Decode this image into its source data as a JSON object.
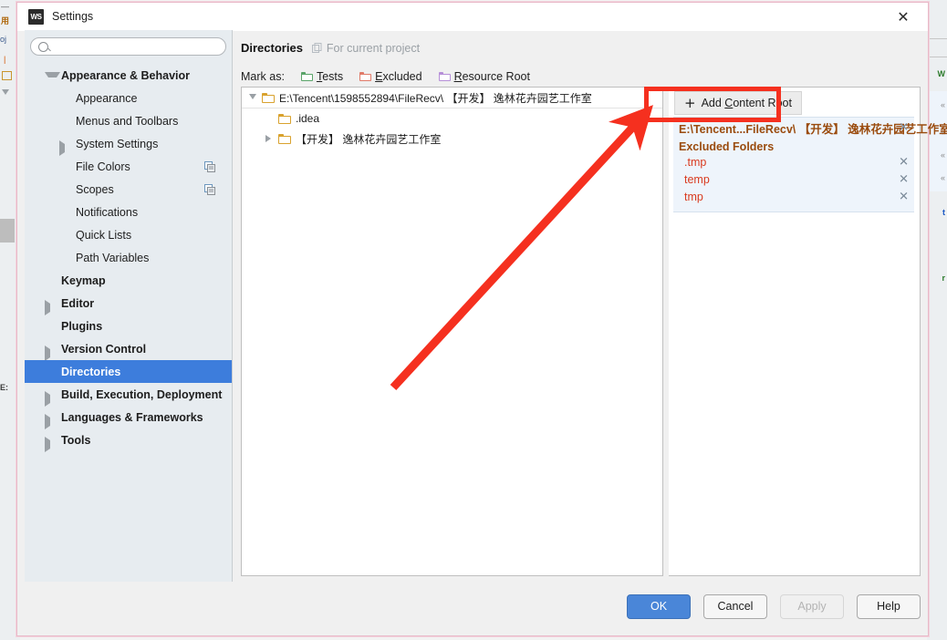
{
  "window": {
    "title": "Settings",
    "app_icon": "WS",
    "close_icon": "✕"
  },
  "search": {
    "value": "",
    "placeholder": "",
    "icon": "search-icon"
  },
  "sidebar": {
    "items": [
      {
        "label": "Appearance & Behavior",
        "indent": 0,
        "bold": true,
        "twisty": "down",
        "selected": false,
        "copy_icon": false
      },
      {
        "label": "Appearance",
        "indent": 1,
        "bold": false,
        "twisty": "none",
        "selected": false,
        "copy_icon": false
      },
      {
        "label": "Menus and Toolbars",
        "indent": 1,
        "bold": false,
        "twisty": "none",
        "selected": false,
        "copy_icon": false
      },
      {
        "label": "System Settings",
        "indent": 1,
        "bold": false,
        "twisty": "right",
        "selected": false,
        "copy_icon": false
      },
      {
        "label": "File Colors",
        "indent": 1,
        "bold": false,
        "twisty": "none",
        "selected": false,
        "copy_icon": true
      },
      {
        "label": "Scopes",
        "indent": 1,
        "bold": false,
        "twisty": "none",
        "selected": false,
        "copy_icon": true
      },
      {
        "label": "Notifications",
        "indent": 1,
        "bold": false,
        "twisty": "none",
        "selected": false,
        "copy_icon": false
      },
      {
        "label": "Quick Lists",
        "indent": 1,
        "bold": false,
        "twisty": "none",
        "selected": false,
        "copy_icon": false
      },
      {
        "label": "Path Variables",
        "indent": 1,
        "bold": false,
        "twisty": "none",
        "selected": false,
        "copy_icon": false
      },
      {
        "label": "Keymap",
        "indent": 0,
        "bold": true,
        "twisty": "none",
        "selected": false,
        "copy_icon": false
      },
      {
        "label": "Editor",
        "indent": 0,
        "bold": true,
        "twisty": "right",
        "selected": false,
        "copy_icon": false
      },
      {
        "label": "Plugins",
        "indent": 0,
        "bold": true,
        "twisty": "none",
        "selected": false,
        "copy_icon": false
      },
      {
        "label": "Version Control",
        "indent": 0,
        "bold": true,
        "twisty": "right",
        "selected": false,
        "copy_icon": false
      },
      {
        "label": "Directories",
        "indent": 0,
        "bold": true,
        "twisty": "none",
        "selected": true,
        "copy_icon": false
      },
      {
        "label": "Build, Execution, Deployment",
        "indent": 0,
        "bold": true,
        "twisty": "right",
        "selected": false,
        "copy_icon": false
      },
      {
        "label": "Languages & Frameworks",
        "indent": 0,
        "bold": true,
        "twisty": "right",
        "selected": false,
        "copy_icon": false
      },
      {
        "label": "Tools",
        "indent": 0,
        "bold": true,
        "twisty": "right",
        "selected": false,
        "copy_icon": false
      }
    ]
  },
  "main": {
    "title": "Directories",
    "scope_text": "For current project",
    "scope_icon": "project-scope-icon",
    "mark_as": {
      "label": "Mark as:",
      "options": [
        {
          "label": "Tests",
          "mnemonic": "T",
          "rest": "ests",
          "color": "#5aa469"
        },
        {
          "label": "Excluded",
          "mnemonic": "E",
          "rest": "xcluded",
          "color": "#e07a68"
        },
        {
          "label": "Resource Root",
          "mnemonic": "R",
          "rest": "esource Root",
          "color": "#b68fd8"
        }
      ]
    },
    "tree": [
      {
        "label": "E:\\Tencent\\1598552894\\FileRecv\\ 【开发】 逸林花卉园艺工作室",
        "indent": 0,
        "twisty": "down"
      },
      {
        "label": ".idea",
        "indent": 1,
        "twisty": "none"
      },
      {
        "label": "【开发】 逸林花卉园艺工作室",
        "indent": 1,
        "twisty": "right"
      }
    ]
  },
  "right_panel": {
    "add_button": {
      "plus": "+",
      "label_mnemonic": "Add ",
      "label_key": "C",
      "label_rest": "ontent Root"
    },
    "content_root": {
      "path": "E:\\Tencent...FileRecv\\ 【开发】 逸林花卉园艺工作室",
      "remove_icon": "✕"
    },
    "excluded_header": "Excluded Folders",
    "excluded_folders": [
      {
        "name": ".tmp",
        "remove_icon": "✕"
      },
      {
        "name": "temp",
        "remove_icon": "✕"
      },
      {
        "name": "tmp",
        "remove_icon": "✕"
      }
    ]
  },
  "buttons": [
    {
      "label": "OK",
      "style": "primary"
    },
    {
      "label": "Cancel",
      "style": "normal"
    },
    {
      "label": "Apply",
      "style": "disabled"
    },
    {
      "label": "Help",
      "style": "normal"
    }
  ],
  "annotation": {
    "highlight_color": "#f5301f",
    "arrow_color": "#f5301f"
  },
  "background": {
    "left_fragments": [
      "—",
      "用",
      "oj",
      "|",
      "⬛"
    ],
    "right_fragments": [
      "W",
      "t",
      "r"
    ]
  }
}
